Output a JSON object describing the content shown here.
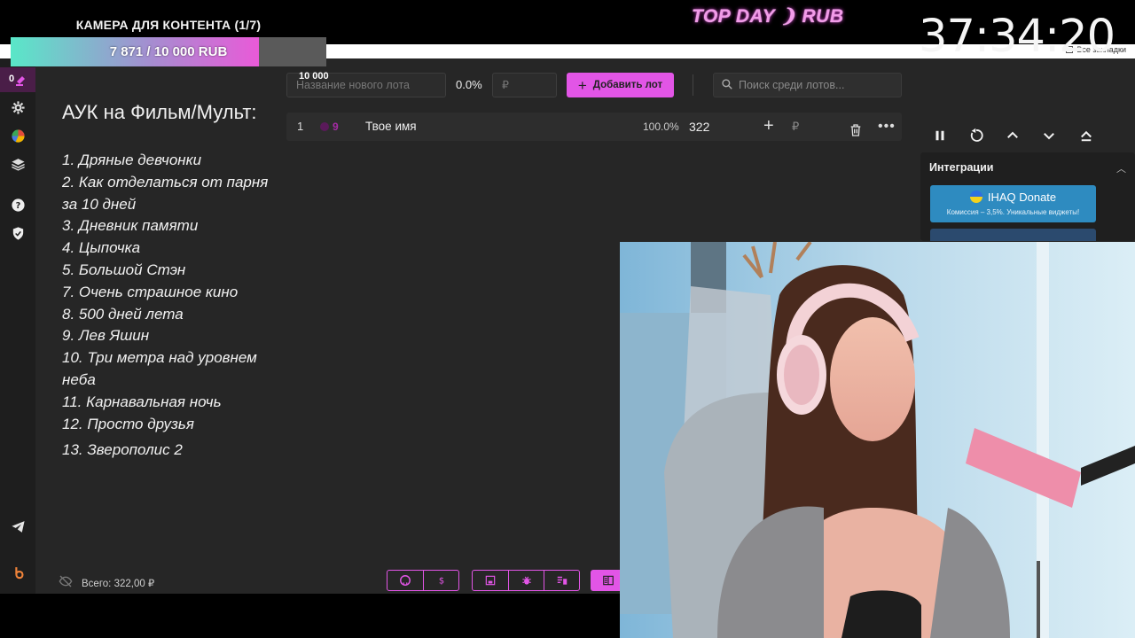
{
  "overlay": {
    "goal": {
      "title": "КАМЕРА ДЛЯ КОНТЕНТА (1/7)",
      "progress_text": "7 871 / 10 000 RUB",
      "current": 7871,
      "target": 10000,
      "max_label": "10 000",
      "colors": {
        "start": "#59e7c8",
        "end": "#e95ad8",
        "track": "#5a5a5a"
      }
    },
    "banner": "TOP DAY ❩ RUB"
  },
  "browser": {
    "bookmarks_label": "Все закладки"
  },
  "rail": {
    "badge": "0",
    "icons": [
      "auction-icon",
      "gear-icon",
      "pie-chart-icon",
      "layers-icon",
      "help-icon",
      "shield-check-icon",
      "telegram-icon",
      "brand-logo-icon"
    ]
  },
  "notes": {
    "title": "АУК на Фильм/Мульт:",
    "items": [
      "1. Дряные девчонки",
      "2. Как отделаться от парня за 10 дней",
      "3. Дневник памяти",
      "4. Цыпочка",
      "5. Большой Стэн",
      "7. Очень страшное кино",
      "8. 500 дней лета",
      "9. Лев Яшин",
      "10. Три метра над уровнем неба",
      "11. Карнавальная ночь",
      "12. Просто друзья",
      "13. Зверополис 2"
    ],
    "total_label": "Всего:",
    "total_value": "322,00 ₽"
  },
  "toolbar": {
    "new_lot_placeholder": "Название нового лота",
    "percent": "0.0%",
    "amount_placeholder": "₽",
    "add_button": "Добавить лот",
    "search_placeholder": "Поиск среди лотов..."
  },
  "lots": [
    {
      "num": "1",
      "idx": "9",
      "name": "Твое имя",
      "pct": "100.0%",
      "amount": "322",
      "currency": "₽"
    }
  ],
  "bottom_tools": [
    "github-icon",
    "dollar-icon",
    "save-icon",
    "bug-icon",
    "delete-list-icon",
    "panel-toggle-icon"
  ],
  "timer": {
    "value": "37:34:20",
    "controls": [
      "pause-icon",
      "restart-icon",
      "chevron-up-icon",
      "chevron-down-icon",
      "eject-icon"
    ]
  },
  "integrations": {
    "title": "Интеграции",
    "donate_name": "IHAQ Donate",
    "donate_sub": "Комиссия – 3,5%. Уникальные виджеты!"
  },
  "accent": "#e255e6"
}
